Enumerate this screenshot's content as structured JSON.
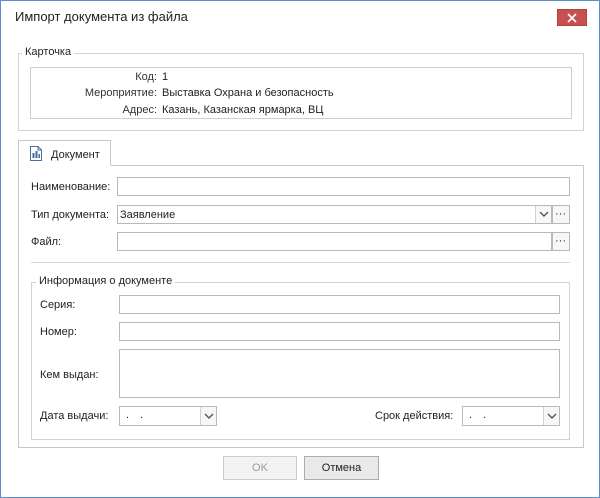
{
  "window": {
    "title": "Импорт документа из файла"
  },
  "card": {
    "legend": "Карточка",
    "code_label": "Код:",
    "code_value": "1",
    "event_label": "Мероприятие:",
    "event_value": "Выставка Охрана и безопасность",
    "address_label": "Адрес:",
    "address_value": "Казань,  Казанская ярмарка, ВЦ"
  },
  "tab": {
    "label": "Документ"
  },
  "form": {
    "name_label": "Наименование:",
    "name_value": "",
    "doc_type_label": "Тип документа:",
    "doc_type_value": "Заявление",
    "file_label": "Файл:",
    "file_value": "",
    "dots": "···"
  },
  "doc_info": {
    "legend": "Информация о документе",
    "series_label": "Серия:",
    "number_label": "Номер:",
    "issued_by_label": "Кем выдан:",
    "issue_date_label": "Дата выдачи:",
    "issue_date_value": ". .",
    "valid_until_label": "Срок действия:",
    "valid_until_value": ". ."
  },
  "buttons": {
    "ok": "OK",
    "cancel": "Отмена"
  }
}
